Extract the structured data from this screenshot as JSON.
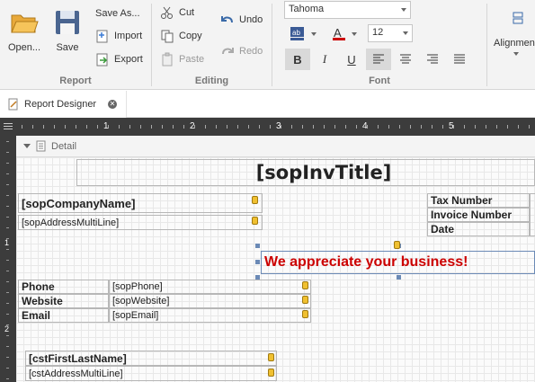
{
  "ribbon": {
    "report": {
      "open_label": "Open...",
      "save_label": "Save",
      "save_as_label": "Save As...",
      "import_label": "Import",
      "export_label": "Export",
      "group_label": "Report"
    },
    "editing": {
      "cut_label": "Cut",
      "copy_label": "Copy",
      "paste_label": "Paste",
      "undo_label": "Undo",
      "redo_label": "Redo",
      "group_label": "Editing"
    },
    "font": {
      "family": "Tahoma",
      "size": "12",
      "bold_label": "B",
      "italic_label": "I",
      "underline_label": "U",
      "group_label": "Font"
    },
    "alignment_label": "Alignment",
    "colors": {
      "accent_red": "#cc0000",
      "text_highlight": "#3a5a95"
    }
  },
  "tab": {
    "label": "Report Designer"
  },
  "ruler": {
    "numbers": [
      "1",
      "2",
      "3",
      "4",
      "5"
    ],
    "vertical_numbers": [
      "1",
      "2"
    ]
  },
  "band": {
    "label": "Detail"
  },
  "fields": {
    "title": "[sopInvTitle]",
    "company_name": "[sopCompanyName]",
    "address": "[sopAddressMultiLine]",
    "tax_number": "Tax Number",
    "invoice_number": "Invoice Number",
    "date": "Date",
    "appreciate": "We appreciate your business!",
    "phone_label": "Phone",
    "phone_value": "[sopPhone]",
    "website_label": "Website",
    "website_value": "[sopWebsite]",
    "email_label": "Email",
    "email_value": "[sopEmail]",
    "customer_name": "[cstFirstLastName]",
    "customer_address": "[cstAddressMultiLine]"
  }
}
